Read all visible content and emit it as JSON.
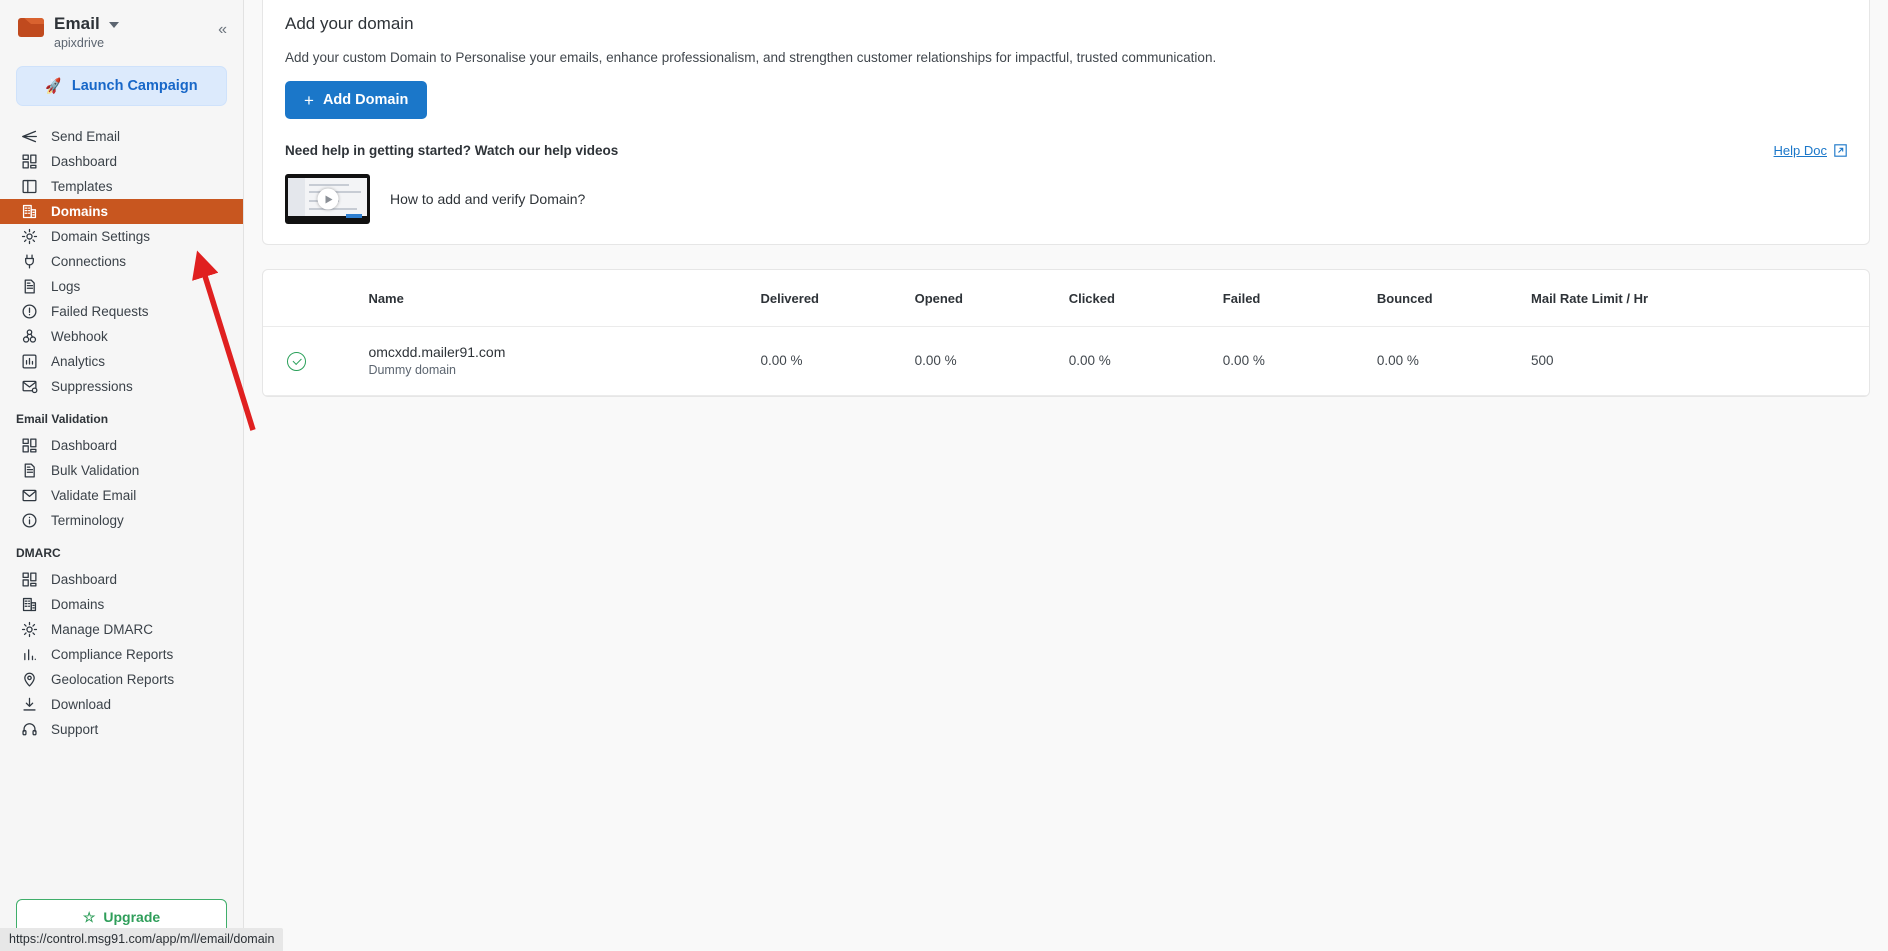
{
  "sidebar": {
    "brand": {
      "title": "Email",
      "subtitle": "apixdrive",
      "icon": "envelope-icon",
      "chevron": "chevron-down-icon"
    },
    "collapse_label": "«",
    "launch_campaign": {
      "label": "Launch Campaign",
      "icon": "rocket-icon"
    },
    "primary_items": [
      {
        "label": "Send Email",
        "icon": "send-icon",
        "active": false
      },
      {
        "label": "Dashboard",
        "icon": "dashboard-grid-icon",
        "active": false
      },
      {
        "label": "Templates",
        "icon": "template-icon",
        "active": false
      },
      {
        "label": "Domains",
        "icon": "building-icon",
        "active": true
      },
      {
        "label": "Domain Settings",
        "icon": "gear-icon",
        "active": false
      },
      {
        "label": "Connections",
        "icon": "plug-icon",
        "active": false
      },
      {
        "label": "Logs",
        "icon": "document-icon",
        "active": false
      },
      {
        "label": "Failed Requests",
        "icon": "alert-circle-icon",
        "active": false
      },
      {
        "label": "Webhook",
        "icon": "webhook-icon",
        "active": false
      },
      {
        "label": "Analytics",
        "icon": "chart-square-icon",
        "active": false
      },
      {
        "label": "Suppressions",
        "icon": "mail-block-icon",
        "active": false
      }
    ],
    "group_email_validation": {
      "title": "Email Validation",
      "items": [
        {
          "label": "Dashboard",
          "icon": "dashboard-grid-icon"
        },
        {
          "label": "Bulk Validation",
          "icon": "document-icon"
        },
        {
          "label": "Validate Email",
          "icon": "envelope-icon"
        },
        {
          "label": "Terminology",
          "icon": "info-circle-icon"
        }
      ]
    },
    "group_dmarc": {
      "title": "DMARC",
      "items": [
        {
          "label": "Dashboard",
          "icon": "dashboard-grid-icon"
        },
        {
          "label": "Domains",
          "icon": "building-icon"
        },
        {
          "label": "Manage DMARC",
          "icon": "gear-icon"
        },
        {
          "label": "Compliance Reports",
          "icon": "bar-chart-icon"
        },
        {
          "label": "Geolocation Reports",
          "icon": "map-pin-icon"
        },
        {
          "label": "Download",
          "icon": "download-icon"
        },
        {
          "label": "Support",
          "icon": "headset-icon"
        }
      ]
    },
    "upgrade": {
      "label": "Upgrade",
      "icon": "star-icon"
    },
    "colors": {
      "active_bg": "#c8561f",
      "launch_bg": "#dceafc",
      "launch_text": "#1767c8",
      "upgrade_border": "#3fae6a",
      "upgrade_text": "#2f9e5a"
    }
  },
  "main": {
    "title": "Add your domain",
    "description": "Add your custom Domain to Personalise your emails, enhance professionalism, and strengthen customer relationships for impactful, trusted communication.",
    "add_domain_button": {
      "label": "Add Domain",
      "icon": "plus-icon",
      "color": "#1b77c9"
    },
    "help_question": "Need help in getting started? Watch our help videos",
    "help_doc": {
      "label": "Help Doc",
      "icon": "external-link-icon",
      "color": "#1b77c9"
    },
    "video": {
      "title": "How to add and verify Domain?",
      "play_icon": "play-icon"
    }
  },
  "table": {
    "columns": [
      "",
      "Name",
      "Delivered",
      "Opened",
      "Clicked",
      "Failed",
      "Bounced",
      "Mail Rate Limit / Hr"
    ],
    "rows": [
      {
        "status_icon": "check-circle-icon",
        "status_color": "#2aa05a",
        "name": "omcxdd.mailer91.com",
        "subtitle": "Dummy domain",
        "delivered": "0.00 %",
        "opened": "0.00 %",
        "clicked": "0.00 %",
        "failed": "0.00 %",
        "bounced": "0.00 %",
        "mail_rate_limit": "500"
      }
    ]
  },
  "overlay": {
    "annotation_arrow": {
      "color": "#e02020",
      "points_to": "domain-settings-nav-item"
    },
    "status_url": "https://control.msg91.com/app/m/l/email/domain"
  }
}
